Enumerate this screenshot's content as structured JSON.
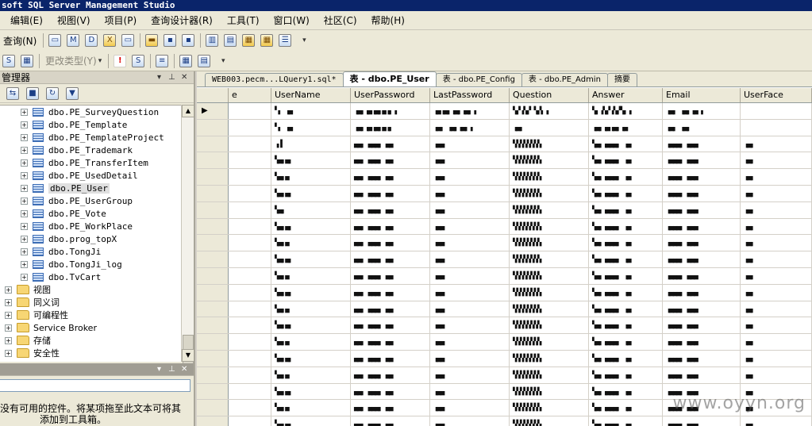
{
  "window": {
    "title": "soft SQL Server Management Studio"
  },
  "menu": [
    "编辑(E)",
    "视图(V)",
    "项目(P)",
    "查询设计器(R)",
    "工具(T)",
    "窗口(W)",
    "社区(C)",
    "帮助(H)"
  ],
  "toolbar": {
    "query_label": "查询(N)",
    "change_type_label": "更改类型(Y)"
  },
  "object_explorer": {
    "title": "管理器",
    "tables": [
      "dbo.PE_SurveyQuestion",
      "dbo.PE_Template",
      "dbo.PE_TemplateProject",
      "dbo.PE_Trademark",
      "dbo.PE_TransferItem",
      "dbo.PE_UsedDetail",
      "dbo.PE_User",
      "dbo.PE_UserGroup",
      "dbo.PE_Vote",
      "dbo.PE_WorkPlace",
      "dbo.prog_topX",
      "dbo.TongJi",
      "dbo.TongJi_log",
      "dbo.TvCart"
    ],
    "folders": [
      "视图",
      "同义词",
      "可编程性",
      "Service Broker",
      "存储",
      "安全性"
    ]
  },
  "toolbox": {
    "message_line1": "没有可用的控件。将某项拖至此文本可将其",
    "message_line2": "添加到工具箱。"
  },
  "tabs": [
    "WEB003.pecm...LQuery1.sql*",
    "表 - dbo.PE_User",
    "表 - dbo.PE_Config",
    "表 - dbo.PE_Admin",
    "摘要"
  ],
  "grid": {
    "columns": [
      "e",
      "UserName",
      "UserPassword",
      "LastPassword",
      "Question",
      "Answer",
      "Email",
      "UserFace"
    ],
    "rows": [
      [
        "",
        "▘▖ ▗▄",
        "▗▄▖▗▄▗▄▖▄▗▖▗",
        "▗▄▗▄▖▗▄▖▗▄▖▗",
        "▚▞▗▚▞ ▚▞▖▗",
        "▚▖▗▚▞▗▚▞▚▖▗",
        "▗▄▖ ▗▄▖▗▄ ▖",
        ""
      ],
      [
        "",
        "▘▖ ▗▄",
        "▗▄▖▗▄▗▄▖▄▗▖",
        "▗▄▖ ▗▄▖▗▄▖▗",
        "▗▄▖",
        "▗▄▖▗▄▗▄▖▗▄",
        "▗▄▖ ▗▄▖",
        ""
      ],
      [
        "",
        "▗▐",
        "▄▄▖ ▄▄▄▖ ▄▄",
        "▗▄▄",
        "▚▚▚▚▚▚▚▚",
        "▚▄▖▗▄▄▄▖ ▗▄",
        "▗▄▄▄▖ ▄▄▄",
        "▗▄▖"
      ],
      [
        "",
        "▚▄▖▄▖",
        "▄▄▖ ▄▄▄▖ ▄▄",
        "▗▄▄",
        "▚▚▚▚▚▚▚▚",
        "▚▄▖▗▄▄▄▖ ▗▄",
        "▗▄▄▄▖ ▄▄▄",
        "▗▄▖"
      ],
      [
        "",
        "▚▄▖▄",
        "▄▄▖ ▄▄▄▖ ▄▄",
        "▗▄▄",
        "▚▚▚▚▚▚▚▚",
        "▚▄▖▗▄▄▄▖ ▗▄",
        "▗▄▄▄▖ ▄▄▄",
        "▗▄▖"
      ],
      [
        "",
        "▚▄▖▄▖",
        "▄▄▖ ▄▄▄▖ ▄▄",
        "▗▄▄",
        "▚▚▚▚▚▚▚▚",
        "▚▄▖▗▄▄▄▖ ▗▄",
        "▗▄▄▄▖ ▄▄▄",
        "▗▄▖"
      ],
      [
        "",
        "▚▄▖",
        "▄▄▖ ▄▄▄▖ ▄▄",
        "▗▄▄",
        "▚▚▚▚▚▚▚▚",
        "▚▄▖▗▄▄▄▖ ▗▄",
        "▗▄▄▄▖ ▄▄▄",
        "▗▄▖"
      ],
      [
        "",
        "▚▄▖▄▖",
        "▄▄▖ ▄▄▄▖ ▄▄",
        "▗▄▄",
        "▚▚▚▚▚▚▚▚",
        "▚▄▖▗▄▄▄▖ ▗▄",
        "▗▄▄▄▖ ▄▄▄",
        "▗▄▖"
      ],
      [
        "",
        "▚▄▖▄",
        "▄▄▖ ▄▄▄▖ ▄▄",
        "▗▄▄",
        "▚▚▚▚▚▚▚▚",
        "▚▄▖▗▄▄▄▖ ▗▄",
        "▗▄▄▄▖ ▄▄▄",
        "▗▄▖"
      ],
      [
        "",
        "▚▄▖▄▖",
        "▄▄▖ ▄▄▄▖ ▄▄",
        "▗▄▄",
        "▚▚▚▚▚▚▚▚",
        "▚▄▖▗▄▄▄▖ ▗▄",
        "▗▄▄▄▖ ▄▄▄",
        "▗▄▖"
      ],
      [
        "",
        "▚▄▖▄",
        "▄▄▖ ▄▄▄▖ ▄▄",
        "▗▄▄",
        "▚▚▚▚▚▚▚▚",
        "▚▄▖▗▄▄▄▖ ▗▄",
        "▗▄▄▄▖ ▄▄▄",
        "▗▄▖"
      ],
      [
        "",
        "▚▄▖▄▖",
        "▄▄▖ ▄▄▄▖ ▄▄",
        "▗▄▄",
        "▚▚▚▚▚▚▚▚",
        "▚▄▖▗▄▄▄▖ ▗▄",
        "▗▄▄▄▖ ▄▄▄",
        "▗▄▖"
      ],
      [
        "",
        "▚▄▖▄",
        "▄▄▖ ▄▄▄▖ ▄▄",
        "▗▄▄",
        "▚▚▚▚▚▚▚▚",
        "▚▄▖▗▄▄▄▖ ▗▄",
        "▗▄▄▄▖ ▄▄▄",
        "▗▄▖"
      ],
      [
        "",
        "▚▄▖▄▖",
        "▄▄▖ ▄▄▄▖ ▄▄",
        "▗▄▄",
        "▚▚▚▚▚▚▚▚",
        "▚▄▖▗▄▄▄▖ ▗▄",
        "▗▄▄▄▖ ▄▄▄",
        "▗▄▖"
      ],
      [
        "",
        "▚▄▖▄",
        "▄▄▖ ▄▄▄▖ ▄▄",
        "▗▄▄",
        "▚▚▚▚▚▚▚▚",
        "▚▄▖▗▄▄▄▖ ▗▄",
        "▗▄▄▄▖ ▄▄▄",
        "▗▄▖"
      ],
      [
        "",
        "▚▄▖▄▖",
        "▄▄▖ ▄▄▄▖ ▄▄",
        "▗▄▄",
        "▚▚▚▚▚▚▚▚",
        "▚▄▖▗▄▄▄▖ ▗▄",
        "▗▄▄▄▖ ▄▄▄",
        "▗▄▖"
      ],
      [
        "",
        "▚▄▖▄",
        "▄▄▖ ▄▄▄▖ ▄▄",
        "▗▄▄",
        "▚▚▚▚▚▚▚▚",
        "▚▄▖▗▄▄▄▖ ▗▄",
        "▗▄▄▄▖ ▄▄▄",
        "▗▄▖"
      ],
      [
        "",
        "▚▄▖▄▖",
        "▄▄▖ ▄▄▄▖ ▄▄",
        "▗▄▄",
        "▚▚▚▚▚▚▚▚",
        "▚▄▖▗▄▄▄▖ ▗▄",
        "▗▄▄▄▖ ▄▄▄",
        "▗▄▖"
      ],
      [
        "",
        "▚▄▖▄",
        "▄▄▖ ▄▄▄▖ ▄▄",
        "▗▄▄",
        "▚▚▚▚▚▚▚▚",
        "▚▄▖▗▄▄▄▖ ▗▄",
        "▗▄▄▄▖ ▄▄▄",
        "▗▄▖"
      ],
      [
        "",
        "▚▄▖▄▖",
        "▄▄▖ ▄▄▄▖ ▄▄",
        "▗▄▄",
        "▚▚▚▚▚▚▚▚",
        "▚▄▖▗▄▄▄▖ ▗▄",
        "▗▄▄▄▖ ▄▄▄",
        "▗▄▖"
      ]
    ]
  },
  "watermark": "www.oyyn.org",
  "colors": {
    "title_bar": "#0a246a",
    "chrome": "#ece9d8",
    "grid_bg": "#ffffff"
  }
}
